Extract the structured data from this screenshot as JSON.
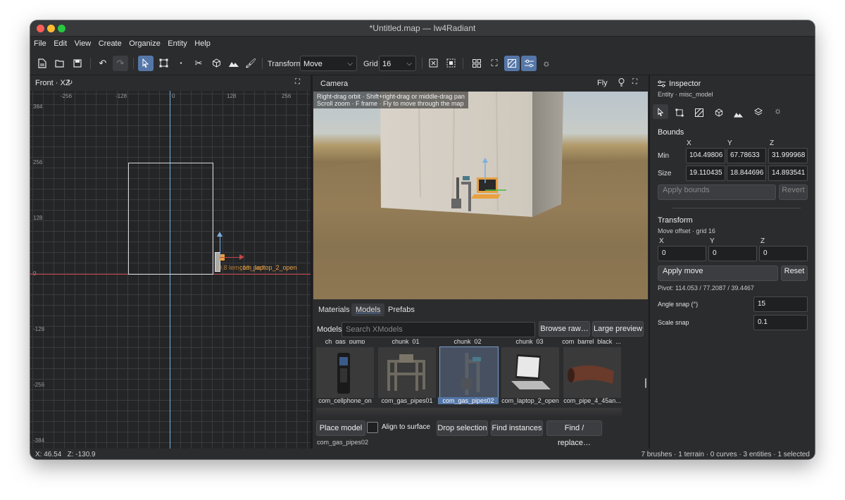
{
  "window": {
    "title": "*Untitled.map — Iw4Radiant"
  },
  "menu": [
    "File",
    "Edit",
    "View",
    "Create",
    "Organize",
    "Entity",
    "Help"
  ],
  "toolbar": {
    "transform_label": "Transform",
    "transform_value": "Move",
    "grid_label": "Grid",
    "grid_value": "16"
  },
  "front_view": {
    "title": "Front · XZ",
    "x_ticks": [
      "-256",
      "-128",
      "0",
      "128",
      "256"
    ],
    "y_ticks": [
      "384",
      "256",
      "128",
      "0",
      "-128",
      "-256",
      "-384"
    ],
    "entity_label": "com_laptop_2_open",
    "entity_label_overlap": "9.8 lem_16_ped"
  },
  "camera": {
    "title": "Camera",
    "mode": "Fly",
    "hint_line1": "Right-drag orbit · Shift+right-drag or middle-drag pan",
    "hint_line2": "Scroll zoom · F frame · Fly to move through the map"
  },
  "browser": {
    "tabs": [
      "Materials",
      "Models",
      "Prefabs"
    ],
    "active_tab": "Models",
    "models_label": "Models",
    "search_placeholder": "Search XModels",
    "browse_raw": "Browse raw…",
    "large_preview": "Large preview",
    "top_row_labels": [
      "ch_gas_pump",
      "chunk_01",
      "chunk_02",
      "chunk_03",
      "com_barrel_black_..."
    ],
    "items": [
      {
        "label": "com_cellphone_on",
        "icon": "cellphone-icon"
      },
      {
        "label": "com_gas_pipes01",
        "icon": "gas-pipes-icon"
      },
      {
        "label": "com_gas_pipes02",
        "icon": "gas-pipes-icon",
        "selected": true
      },
      {
        "label": "com_laptop_2_open",
        "icon": "laptop-icon"
      },
      {
        "label": "com_pipe_4_45an...",
        "icon": "pipe-icon"
      }
    ],
    "place_model": "Place model",
    "align_to_surface": "Align to surface",
    "drop_selection": "Drop selection",
    "find_instances": "Find instances",
    "find_replace": "Find / replace…",
    "selected_model": "com_gas_pipes02"
  },
  "inspector": {
    "title": "Inspector",
    "entity": "Entity · misc_model",
    "bounds_title": "Bounds",
    "axis": [
      "X",
      "Y",
      "Z"
    ],
    "min_label": "Min",
    "size_label": "Size",
    "min": [
      "104.49806",
      "67.78633",
      "31.999968"
    ],
    "size": [
      "19.110435",
      "18.844696",
      "14.893541"
    ],
    "apply_bounds": "Apply bounds",
    "revert": "Revert",
    "transform_title": "Transform",
    "move_offset": "Move offset · grid 16",
    "offset": [
      "0",
      "0",
      "0"
    ],
    "apply_move": "Apply move",
    "reset": "Reset",
    "pivot": "Pivot: 114.053 / 77.2087 / 39.4467",
    "angle_snap_label": "Angle snap (°)",
    "angle_snap": "15",
    "scale_snap_label": "Scale snap",
    "scale_snap": "0.1"
  },
  "status": {
    "coords": "X: 46.54   Z: -130.9",
    "summary": "7 brushes · 1 terrain · 0 curves · 3 entities · 1 selected"
  },
  "colors": {
    "accent": "#5577a8",
    "axis_red": "#c0454a",
    "axis_blue": "#7ab0e0",
    "label_orange": "#e8a040"
  }
}
